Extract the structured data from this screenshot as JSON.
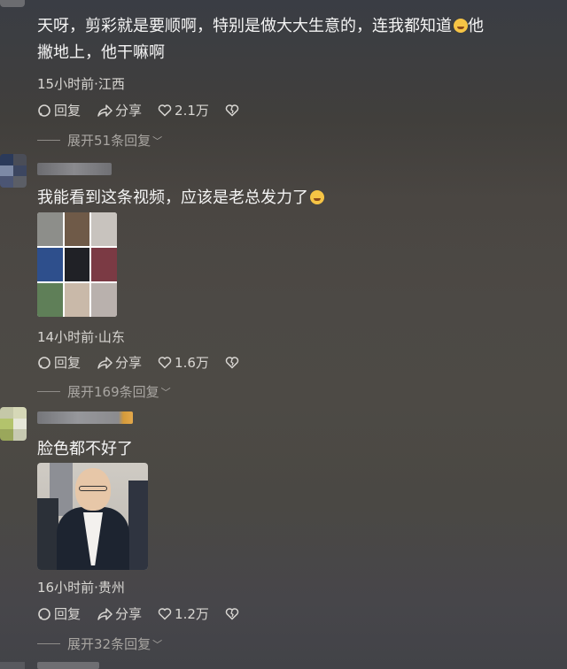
{
  "comments": [
    {
      "text_line1": "天呀，剪彩就是要顺啊，特别是做大大生意的，连我都知道",
      "text_line1_tail": "他",
      "text_line2": "撇地上，他干嘛啊",
      "meta": "15小时前·江西",
      "reply_label": "回复",
      "share_label": "分享",
      "like_count": "2.1万",
      "expand_label": "展开51条回复"
    },
    {
      "text_line1": "我能看到这条视频，应该是老总发力了",
      "meta": "14小时前·山东",
      "reply_label": "回复",
      "share_label": "分享",
      "like_count": "1.6万",
      "expand_label": "展开169条回复"
    },
    {
      "text_line1": "脸色都不好了",
      "meta": "16小时前·贵州",
      "reply_label": "回复",
      "share_label": "分享",
      "like_count": "1.2万",
      "expand_label": "展开32条回复"
    }
  ],
  "icons": {
    "reply": "comment-bubble-icon",
    "share": "share-arrow-icon",
    "like": "heart-icon",
    "dislike": "broken-heart-icon",
    "expand": "chevron-down-icon"
  }
}
